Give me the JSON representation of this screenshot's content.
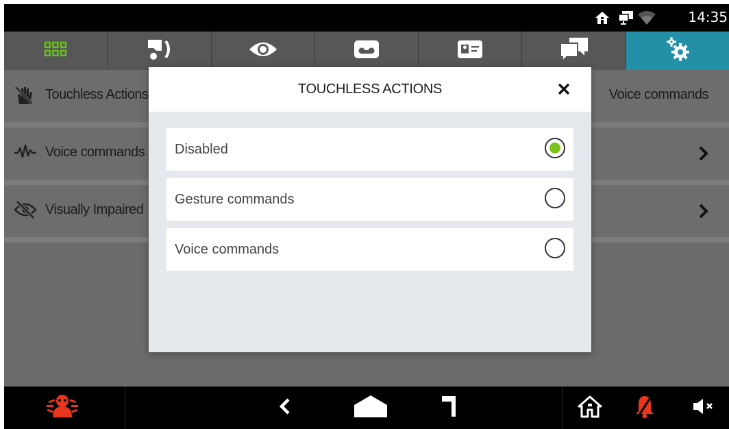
{
  "status": {
    "time": "14:35",
    "icons": [
      "home-icon",
      "monitor-icon",
      "wifi-icon"
    ]
  },
  "tabs": [
    {
      "icon": "grid-icon",
      "active": false
    },
    {
      "icon": "intercom-call-icon",
      "active": false
    },
    {
      "icon": "eye-icon",
      "active": false
    },
    {
      "icon": "voicemail-icon",
      "active": false
    },
    {
      "icon": "contact-card-icon",
      "active": false
    },
    {
      "icon": "chat-icon",
      "active": false
    },
    {
      "icon": "settings-gears-icon",
      "active": true
    }
  ],
  "settings_list": [
    {
      "label": "Touchless Actions",
      "icon": "hand-crossed-icon",
      "value": "Voice commands"
    },
    {
      "label": "Voice commands",
      "icon": "waveform-icon",
      "value": ""
    },
    {
      "label": "Visually Impaired",
      "icon": "eye-crossed-icon",
      "value": ""
    }
  ],
  "dialog": {
    "title": "TOUCHLESS ACTIONS",
    "options": [
      {
        "label": "Disabled",
        "selected": true
      },
      {
        "label": "Gesture commands",
        "selected": false
      },
      {
        "label": "Voice commands",
        "selected": false
      }
    ]
  },
  "navbar": {
    "items": [
      "alarm-icon",
      "back-icon",
      "home-shape-icon",
      "door-icon",
      "house-icon",
      "bell-muted-icon",
      "speaker-muted-icon"
    ]
  },
  "colors": {
    "accent_tab": "#2390a8",
    "selected_radio": "#7ec21e",
    "alarm_red": "#e8361f",
    "grid_green": "#6ac11f"
  }
}
